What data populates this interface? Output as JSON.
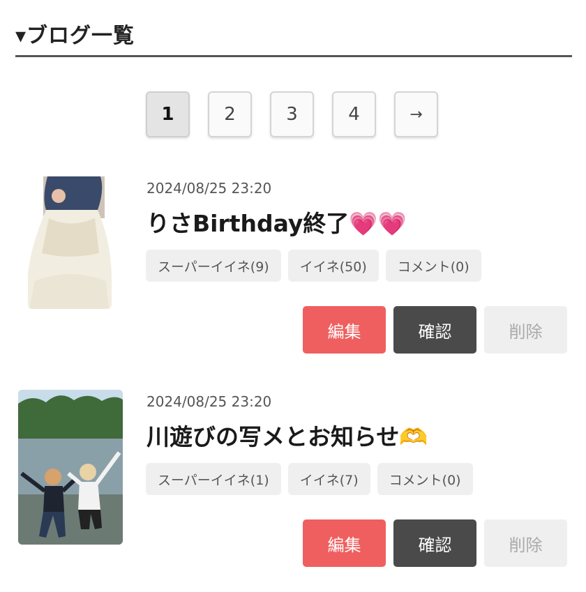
{
  "header": {
    "title": "▾ブログ一覧"
  },
  "pagination": {
    "pages": [
      "1",
      "2",
      "3",
      "4"
    ],
    "current": "1",
    "next_label": "→"
  },
  "posts": [
    {
      "date": "2024/08/25 23:20",
      "title": "りさBirthday終了",
      "title_emoji": "💗💗",
      "tags": [
        "スーパーイイネ(9)",
        "イイネ(50)",
        "コメント(0)"
      ],
      "actions": {
        "edit": "編集",
        "confirm": "確認",
        "delete": "削除"
      }
    },
    {
      "date": "2024/08/25 23:20",
      "title": "川遊びの写メとお知らせ",
      "title_emoji": "🫶",
      "tags": [
        "スーパーイイネ(1)",
        "イイネ(7)",
        "コメント(0)"
      ],
      "actions": {
        "edit": "編集",
        "confirm": "確認",
        "delete": "削除"
      }
    }
  ]
}
